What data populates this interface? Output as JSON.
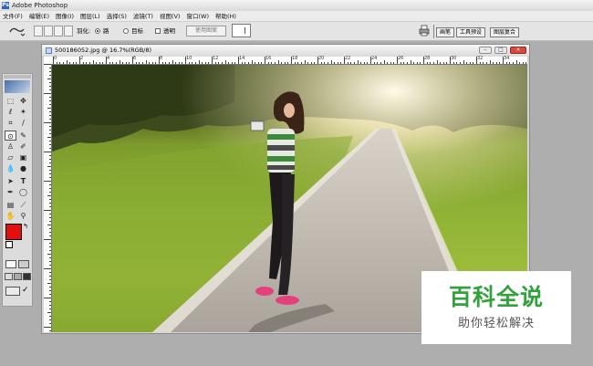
{
  "app": {
    "title": "Adobe Photoshop",
    "logo_text": "Ps"
  },
  "menu": [
    "文件(F)",
    "编辑(E)",
    "图像(I)",
    "图层(L)",
    "选择(S)",
    "滤镜(T)",
    "视图(V)",
    "窗口(W)",
    "帮助(H)"
  ],
  "options": {
    "feather_label": "羽化:",
    "radio_path": "路",
    "radio_target": "目标",
    "transparent_label": "透明",
    "use_pattern_button": "使用图案"
  },
  "palette_tabs": [
    "画笔",
    "工具预设",
    "图层复合"
  ],
  "document": {
    "title": "500186052.jpg @ 16.7%(RGB/8)",
    "ruler_numbers": [
      "0",
      "2",
      "4",
      "6",
      "8",
      "10",
      "12",
      "14",
      "16",
      "18",
      "20",
      "22",
      "24",
      "26",
      "28",
      "30",
      "32",
      "34"
    ]
  },
  "watermark": {
    "main": "百科全说",
    "sub": "助你轻松解决"
  },
  "colors": {
    "foreground": "#e01010",
    "background": "#ffffff",
    "watermark_green": "#33a13c"
  }
}
